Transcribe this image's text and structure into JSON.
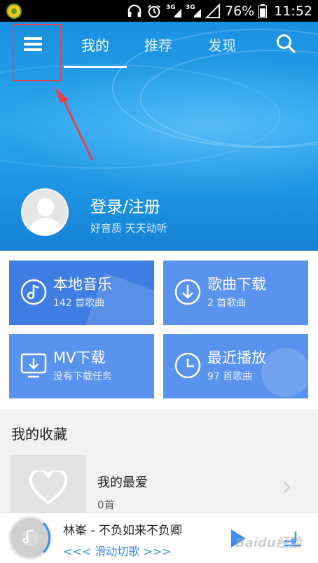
{
  "status_bar": {
    "network_1": "3G",
    "network_2": "3G",
    "battery": "76%",
    "time": "11:52",
    "icons": [
      "app-icon",
      "headphones-icon",
      "alarm-icon",
      "signal-icon",
      "battery-icon"
    ]
  },
  "header": {
    "tabs": [
      {
        "label": "我的",
        "active": true
      },
      {
        "label": "推荐",
        "active": false
      },
      {
        "label": "发现",
        "active": false
      }
    ],
    "menu_icon": "hamburger-menu-icon",
    "search_icon": "search-icon",
    "highlight_color": "#e8434d"
  },
  "profile": {
    "title": "登录/注册",
    "subtitle": "好音质 天天动听"
  },
  "tiles": [
    {
      "title": "本地音乐",
      "subtitle": "142 首歌曲",
      "icon": "music-note-icon"
    },
    {
      "title": "歌曲下载",
      "subtitle": "2 首歌曲",
      "icon": "download-icon"
    },
    {
      "title": "MV下载",
      "subtitle": "没有下载任务",
      "icon": "mv-download-icon"
    },
    {
      "title": "最近播放",
      "subtitle": "97 首歌曲",
      "icon": "clock-icon"
    }
  ],
  "favorites": {
    "heading": "我的收藏",
    "playlist_name": "我的最爱",
    "playlist_count": "0首"
  },
  "player": {
    "song": "林峯 - 不负如来不负卿",
    "swipe_hint": "滑动切歌",
    "watermark": "Baidu经验"
  },
  "colors": {
    "header_blue": "#1d93e3",
    "tile_blue": "#3f7de3",
    "tile_light_blue": "#5a93ee",
    "accent": "#3a8ef0"
  }
}
